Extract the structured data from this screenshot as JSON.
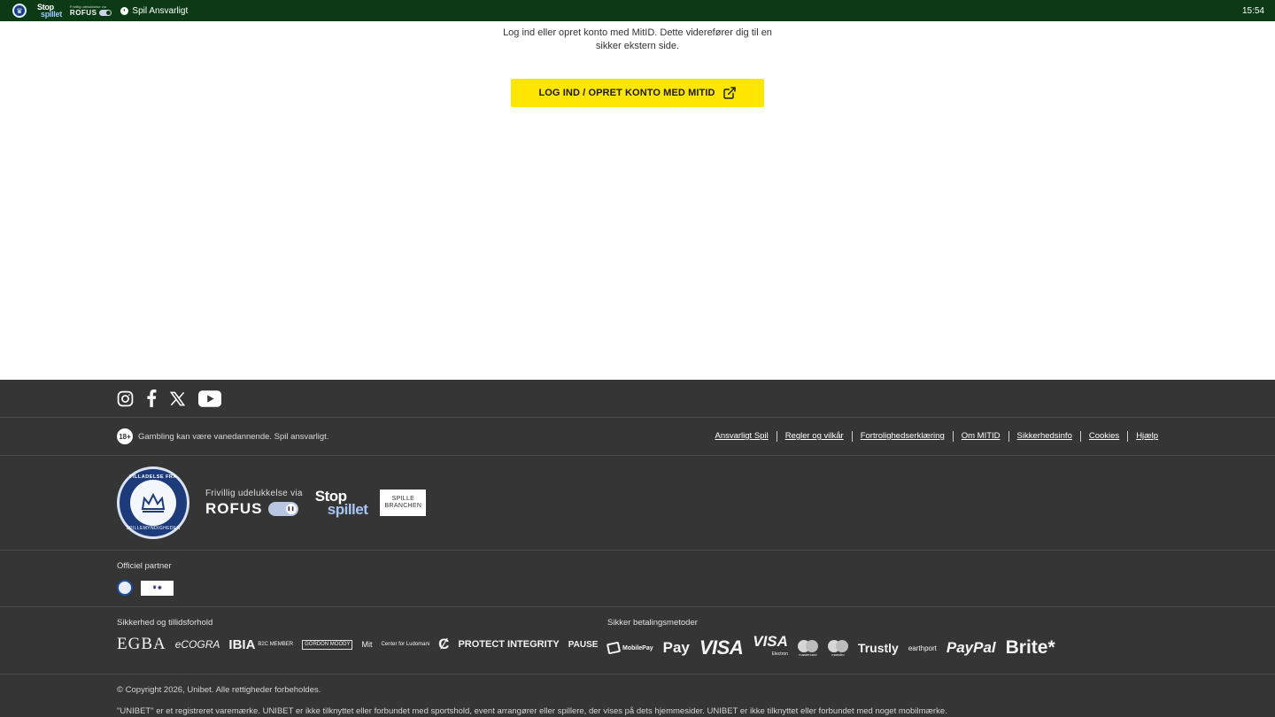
{
  "topbar": {
    "stop_top": "Stop",
    "stop_bottom": "spillet",
    "rofus_small": "Frivillig udelukkelse via",
    "rofus_word": "ROFUS",
    "responsible_label": "Spil Ansvarligt",
    "clock": "15:54"
  },
  "main": {
    "intro_text": "Log ind eller opret konto med MitID. Dette viderefører dig til en sikker ekstern side.",
    "mitid_button_label": "LOG IND / OPRET KONTO MED MITID"
  },
  "footer": {
    "social": [
      "instagram-icon",
      "facebook-icon",
      "x-icon",
      "youtube-icon"
    ],
    "age_badge": "18+",
    "responsible_text": "Gambling kan være vanedannende. Spil ansvarligt.",
    "links": [
      "Ansvarligt Spil",
      "Regler og vilkår",
      "Fortrolighedserklæring",
      "Om MITID",
      "Sikkerhedsinfo",
      "Cookies",
      "Hjælp"
    ],
    "license": {
      "seal_top": "TILLADELSE FRA",
      "seal_bottom": "SPILLEMYNDIGHEDEN",
      "rofus_line": "Frivillig udelukkelse via",
      "rofus_word": "ROFUS",
      "stop_top": "Stop",
      "stop_bottom": "spillet",
      "branchen_line1": "SPILLE",
      "branchen_line2": "BRANCHEN"
    },
    "partner_title": "Officiel partner",
    "security_title": "Sikkerhed og tillidsforhold",
    "security_logos": {
      "egba": "EGBA",
      "ecogra": "eCOGRA",
      "ibia": "IBIA",
      "ibia_sub": "B2C MEMBER",
      "therapy": "GORDON MOODY",
      "mitid": "Mit",
      "cfl": "Center for Ludomani",
      "protect": "PROTECT INTEGRITY",
      "pause": "PAUSE"
    },
    "payment_title": "Sikker betalingsmetoder",
    "payment_logos": {
      "mobilepay": "MobilePay",
      "applepay": "Pay",
      "visa": "VISA",
      "visa_electron": "VISA",
      "visa_electron_sub": "Electron",
      "mastercard_sub": "mastercard",
      "maestro_sub": "maestro",
      "trustly": "Trustly",
      "earthport": "earthport",
      "paypal": "PayPal",
      "brite": "Brite*"
    },
    "copyright": "© Copyright 2026, Unibet. Alle rettigheder forbeholdes.",
    "trademark": "\"UNIBET\" er et registreret varemærke. UNIBET er ikke tilknyttet eller forbundet med sportshold, event arrangører eller spillere, der vises på dets hjemmesider. UNIBET er ikke tilknyttet eller forbundet med noget mobilmærke."
  }
}
